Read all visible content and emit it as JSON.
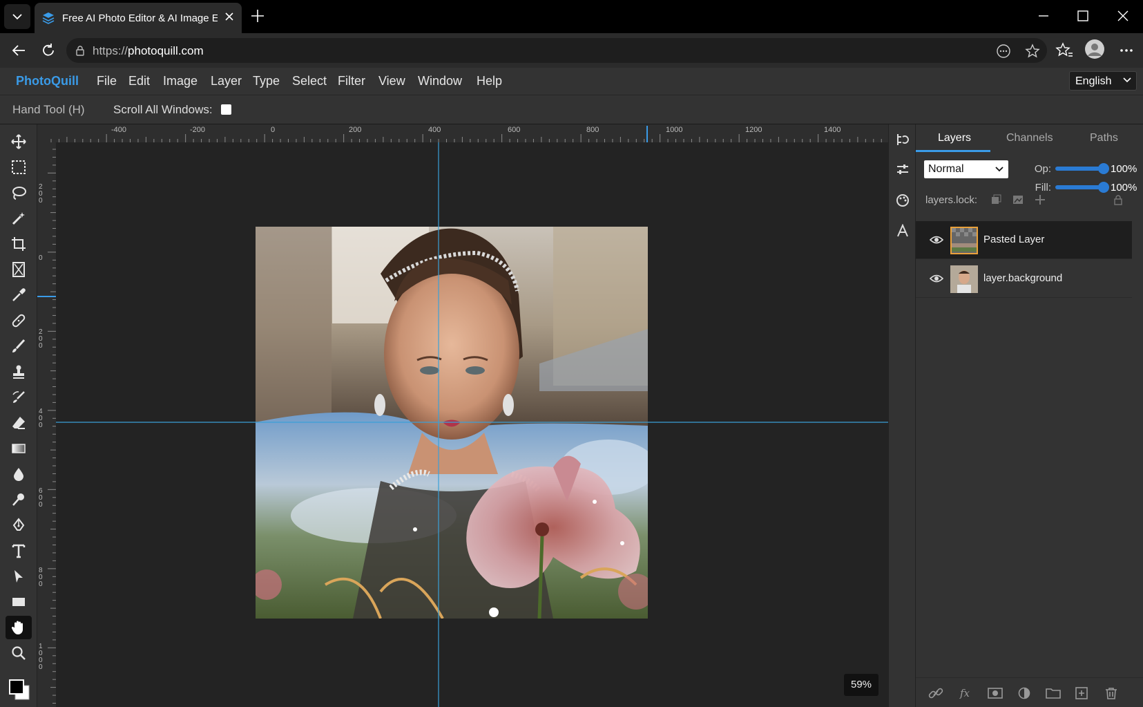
{
  "browser": {
    "tab_title": "Free AI Photo Editor & AI Image Ed",
    "url_prefix": "https://",
    "url_domain": "photoquill.com"
  },
  "app": {
    "brand": "PhotoQuill",
    "menu": [
      "File",
      "Edit",
      "Image",
      "Layer",
      "Type",
      "Select",
      "Filter",
      "View",
      "Window",
      "Help"
    ],
    "language": "English"
  },
  "options": {
    "tool_name": "Hand Tool (H)",
    "scroll_all_label": "Scroll All Windows:"
  },
  "ruler": {
    "top_labels": [
      "-400",
      "-200",
      "0",
      "200",
      "400",
      "600",
      "800",
      "1000",
      "1200",
      "1400"
    ],
    "left_labels": [
      "200",
      "0",
      "200",
      "400",
      "600",
      "800",
      "1000"
    ]
  },
  "canvas": {
    "zoom": "59%"
  },
  "panel": {
    "tabs": [
      "Layers",
      "Channels",
      "Paths"
    ],
    "blend_mode": "Normal",
    "opacity_label": "Op:",
    "opacity_value": "100%",
    "fill_label": "Fill:",
    "fill_value": "100%",
    "lock_label": "layers.lock:",
    "layers": [
      {
        "name": "Pasted Layer",
        "selected": true
      },
      {
        "name": "layer.background",
        "selected": false
      }
    ]
  },
  "colors": {
    "accent": "#3a9be8",
    "selection": "#e9a13b",
    "guide": "#3aa0d8"
  }
}
